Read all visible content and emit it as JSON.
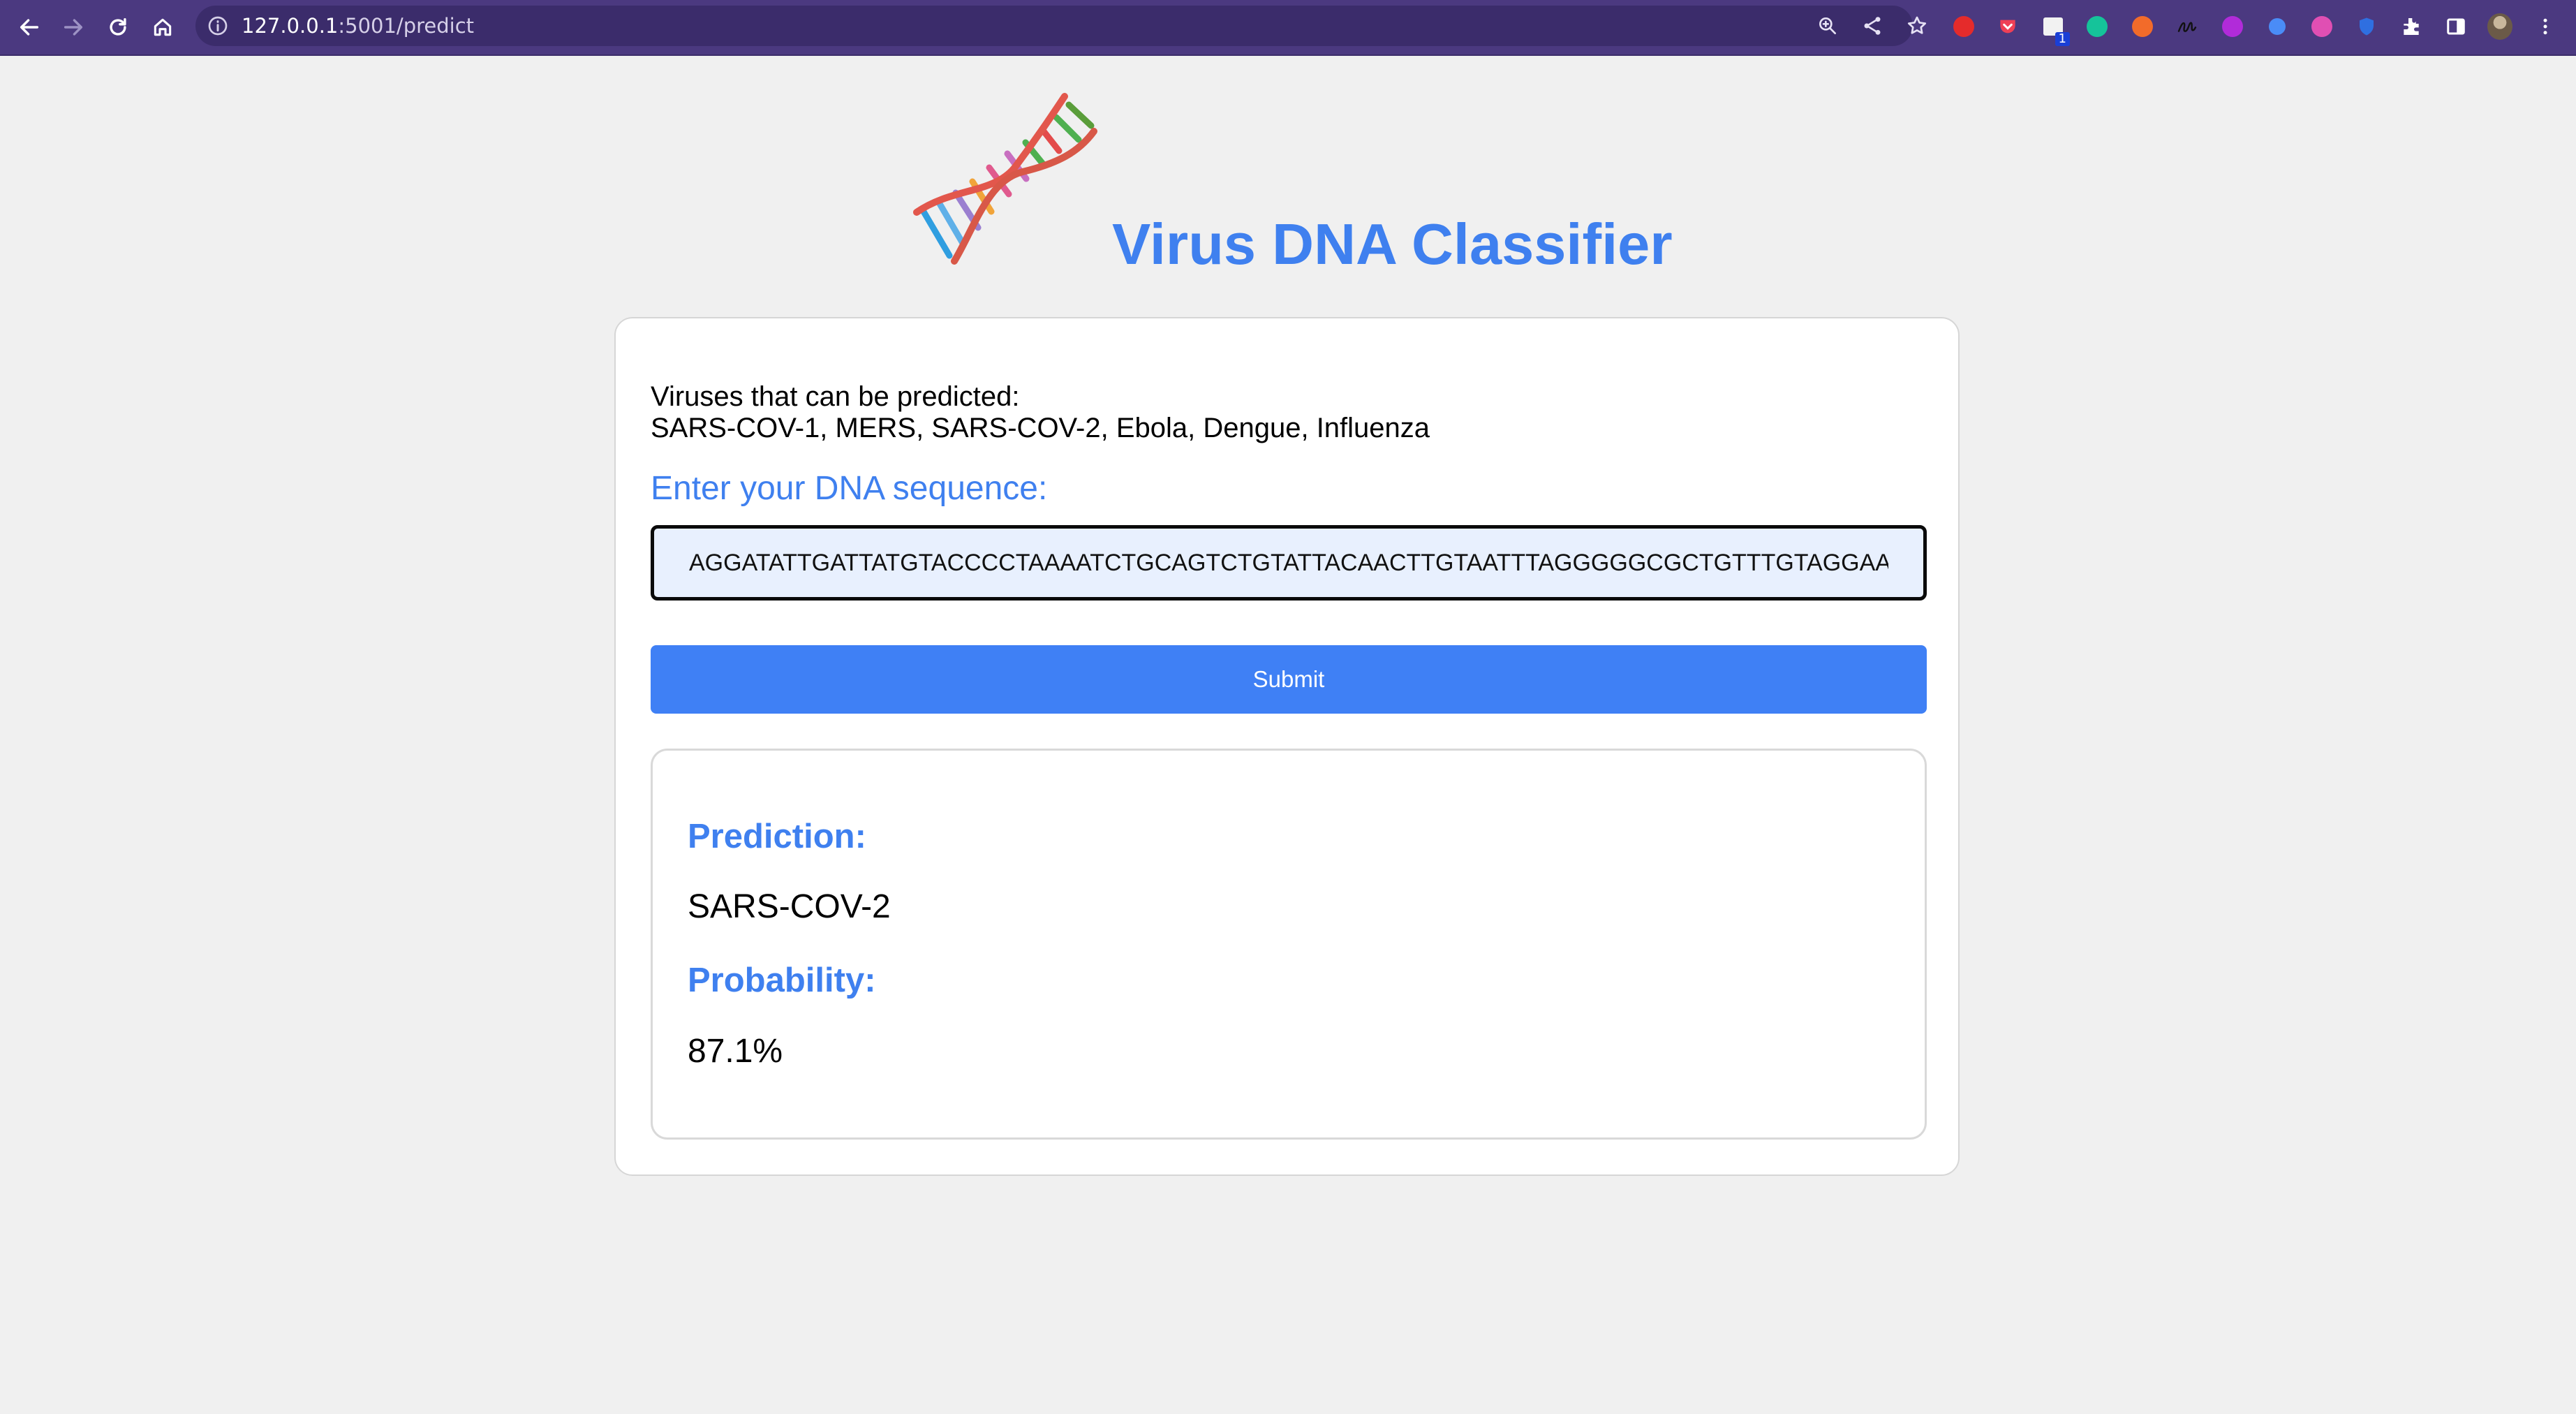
{
  "browser": {
    "url_host": "127.0.0.1",
    "url_path": ":5001/predict",
    "nav_icons": [
      "back-arrow-icon",
      "forward-arrow-icon",
      "reload-icon",
      "home-icon"
    ],
    "omnibox_icons": [
      "site-info-icon",
      "zoom-icon",
      "share-icon",
      "bookmark-star-icon"
    ],
    "extension_badge": "1",
    "colors": {
      "toolbar": "#4b3980",
      "omnibox": "#3b2c6b"
    }
  },
  "header": {
    "logo_icon": "dna-helix-icon",
    "title": "Virus DNA Classifier"
  },
  "form": {
    "intro_line1": "Viruses that can be predicted:",
    "intro_line2": "SARS-COV-1, MERS, SARS-COV-2, Ebola, Dengue, Influenza",
    "sequence_label": "Enter your DNA sequence:",
    "sequence_value": "AGGATATTGATTATGTACCCCTAAAATCTGCAGTCTGTATTACAACTTGTAATTTAGGGGGCGCTGTTTGTAGGAAG",
    "submit_label": "Submit"
  },
  "result": {
    "prediction_label": "Prediction:",
    "prediction_value": "SARS-COV-2",
    "probability_label": "Probability:",
    "probability_value": "87.1%"
  },
  "colors": {
    "accent": "#3f80ef",
    "button": "#3f80f5",
    "page_background": "#f0f0f0"
  }
}
